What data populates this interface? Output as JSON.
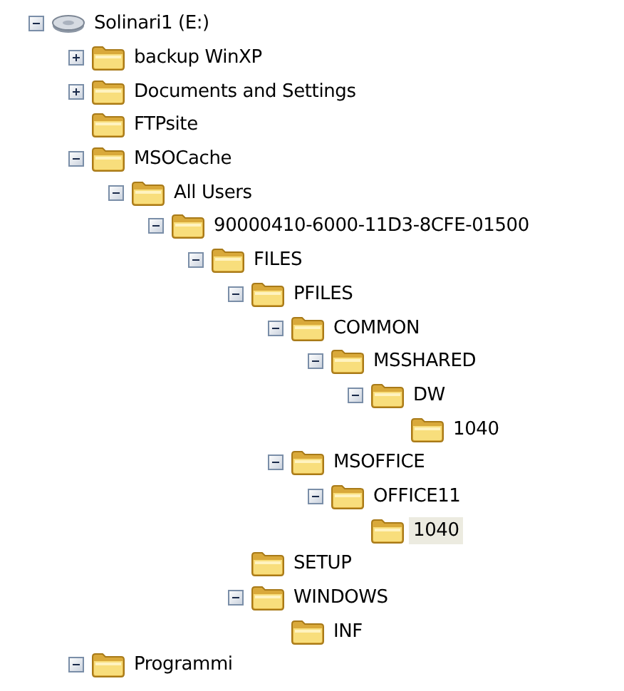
{
  "tree": [
    {
      "label": "Solinari1 (E:)",
      "kind": "drive",
      "expanded": true,
      "selected": false,
      "children": [
        {
          "label": "backup WinXP",
          "kind": "folder",
          "expanded": false,
          "selected": false
        },
        {
          "label": "Documents and Settings",
          "kind": "folder",
          "expanded": false,
          "selected": false
        },
        {
          "label": "FTPsite",
          "kind": "leaf",
          "selected": false
        },
        {
          "label": "MSOCache",
          "kind": "folder",
          "expanded": true,
          "selected": false,
          "children": [
            {
              "label": "All Users",
              "kind": "folder",
              "expanded": true,
              "selected": false,
              "children": [
                {
                  "label": "90000410-6000-11D3-8CFE-01500",
                  "kind": "folder",
                  "expanded": true,
                  "selected": false,
                  "children": [
                    {
                      "label": "FILES",
                      "kind": "folder",
                      "expanded": true,
                      "selected": false,
                      "children": [
                        {
                          "label": "PFILES",
                          "kind": "folder",
                          "expanded": true,
                          "selected": false,
                          "children": [
                            {
                              "label": "COMMON",
                              "kind": "folder",
                              "expanded": true,
                              "selected": false,
                              "children": [
                                {
                                  "label": "MSSHARED",
                                  "kind": "folder",
                                  "expanded": true,
                                  "selected": false,
                                  "children": [
                                    {
                                      "label": "DW",
                                      "kind": "folder",
                                      "expanded": true,
                                      "selected": false,
                                      "children": [
                                        {
                                          "label": "1040",
                                          "kind": "leaf",
                                          "selected": false
                                        }
                                      ]
                                    }
                                  ]
                                }
                              ]
                            },
                            {
                              "label": "MSOFFICE",
                              "kind": "folder",
                              "expanded": true,
                              "selected": false,
                              "children": [
                                {
                                  "label": "OFFICE11",
                                  "kind": "folder",
                                  "expanded": true,
                                  "selected": false,
                                  "children": [
                                    {
                                      "label": "1040",
                                      "kind": "leaf",
                                      "selected": true
                                    }
                                  ]
                                }
                              ]
                            }
                          ]
                        },
                        {
                          "label": "SETUP",
                          "kind": "leaf",
                          "selected": false
                        },
                        {
                          "label": "WINDOWS",
                          "kind": "folder",
                          "expanded": true,
                          "selected": false,
                          "children": [
                            {
                              "label": "INF",
                              "kind": "leaf",
                              "selected": false
                            }
                          ]
                        }
                      ]
                    }
                  ]
                }
              ]
            }
          ]
        },
        {
          "label": "Programmi",
          "kind": "folder",
          "expanded": true,
          "selected": false
        }
      ]
    }
  ]
}
